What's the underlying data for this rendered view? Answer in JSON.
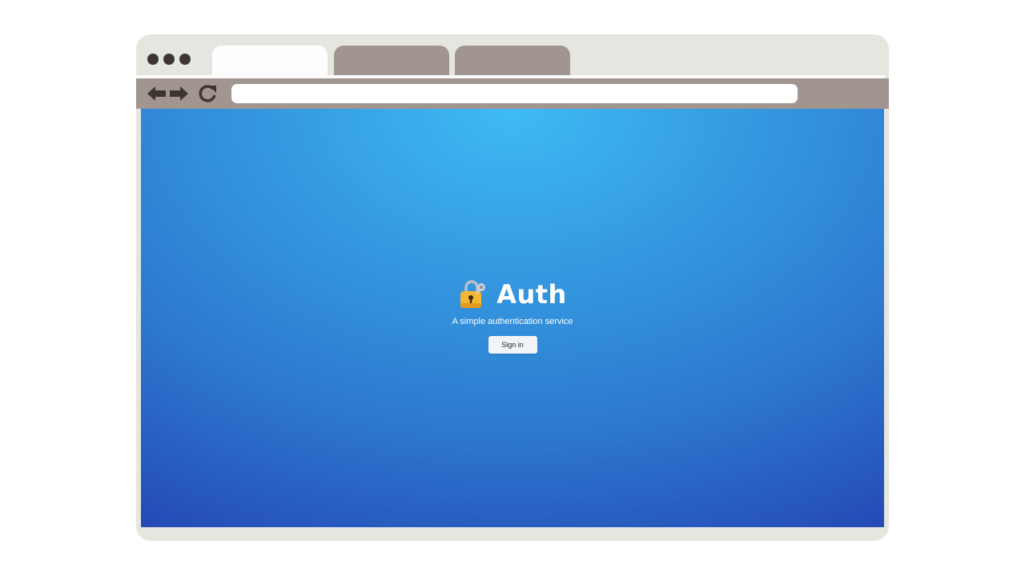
{
  "browser": {
    "tabs": [
      {
        "label": "",
        "active": true
      },
      {
        "label": "",
        "active": false
      },
      {
        "label": "",
        "active": false
      }
    ],
    "address_bar": {
      "value": "",
      "placeholder": ""
    },
    "icons": [
      "back-arrow-icon",
      "forward-arrow-icon",
      "reload-icon"
    ]
  },
  "page": {
    "logo_icon": "lock-with-key-icon",
    "title": "Auth",
    "subtitle": "A simple authentication service",
    "signin_label": "Sign in"
  },
  "colors": {
    "frame": "#e6e6e0",
    "toolbar": "#a1968f",
    "dot": "#3d3433",
    "gradient_top": "#3ebbf4",
    "gradient_bottom": "#2448b4",
    "lock_body": "#f5b731"
  }
}
